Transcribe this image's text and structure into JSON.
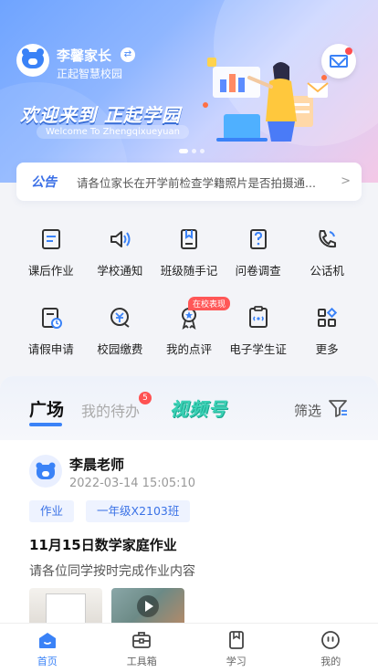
{
  "header": {
    "user_name": "李馨家长",
    "school": "正起智慧校园",
    "welcome": "欢迎来到 正起学园",
    "welcome_en": "Welcome To Zhengqixueyuan"
  },
  "notice": {
    "tag": "公告",
    "text": "请各位家长在开学前检查学籍照片是否拍摄通...",
    "chevron_icon": "chevron-right-icon"
  },
  "grid": {
    "row1": [
      {
        "label": "课后作业",
        "icon": "homework-icon"
      },
      {
        "label": "学校通知",
        "icon": "speaker-icon"
      },
      {
        "label": "班级随手记",
        "icon": "note-icon"
      },
      {
        "label": "问卷调查",
        "icon": "survey-icon"
      },
      {
        "label": "公话机",
        "icon": "phone-icon"
      }
    ],
    "row2": [
      {
        "label": "请假申请",
        "icon": "leave-icon"
      },
      {
        "label": "校园缴费",
        "icon": "payment-icon"
      },
      {
        "label": "我的点评",
        "icon": "badge-icon"
      },
      {
        "label": "电子学生证",
        "icon": "student-card-icon"
      },
      {
        "label": "更多",
        "icon": "more-grid-icon"
      }
    ],
    "badge_tag": "在校表现"
  },
  "feed": {
    "tab_plaza": "广场",
    "tab_todo": "我的待办",
    "todo_count": "5",
    "tab_video": "视频号",
    "filter": "筛选",
    "post": {
      "author": "李晨老师",
      "time": "2022-03-14  15:05:10",
      "chip1": "作业",
      "chip2": "一年级X2103班",
      "title": "11月15日数学家庭作业",
      "desc": "请各位同学按时完成作业内容"
    }
  },
  "bottom_nav": [
    {
      "label": "首页",
      "icon": "home-icon",
      "active": true
    },
    {
      "label": "工具箱",
      "icon": "toolbox-icon",
      "active": false
    },
    {
      "label": "学习",
      "icon": "book-icon",
      "active": false
    },
    {
      "label": "我的",
      "icon": "profile-icon",
      "active": false
    }
  ],
  "colors": {
    "accent": "#3a82f7",
    "video_green": "#3bd1b5",
    "badge_red": "#ff5252"
  }
}
